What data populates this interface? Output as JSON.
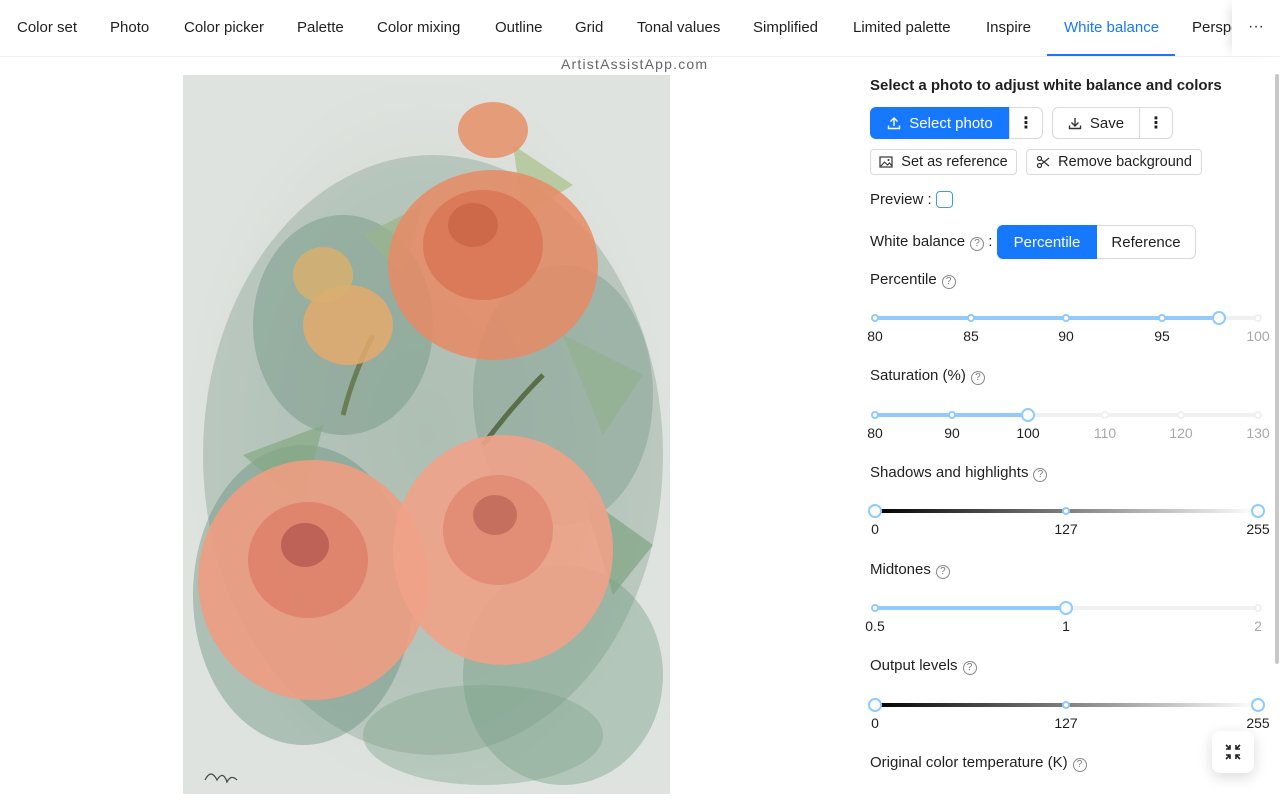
{
  "tabs": [
    {
      "label": "Color set"
    },
    {
      "label": "Photo"
    },
    {
      "label": "Color picker"
    },
    {
      "label": "Palette"
    },
    {
      "label": "Color mixing"
    },
    {
      "label": "Outline"
    },
    {
      "label": "Grid"
    },
    {
      "label": "Tonal values"
    },
    {
      "label": "Simplified"
    },
    {
      "label": "Limited palette"
    },
    {
      "label": "Inspire"
    },
    {
      "label": "White balance",
      "active": true
    },
    {
      "label": "Perspective"
    }
  ],
  "tab_more_icon": "ellipsis-icon",
  "watermark": "ArtistAssistApp.com",
  "panel": {
    "heading": "Select a photo to adjust white balance and colors",
    "select_photo": "Select photo",
    "save": "Save",
    "set_as_reference": "Set as reference",
    "remove_background": "Remove background",
    "preview_label": "Preview",
    "preview_checked": false,
    "white_balance_label": "White balance",
    "white_balance_options": [
      "Percentile",
      "Reference"
    ],
    "white_balance_selected": "Percentile",
    "percentile": {
      "label": "Percentile",
      "marks": [
        "80",
        "85",
        "90",
        "95",
        "100"
      ],
      "min": 80,
      "max": 100,
      "value": 98
    },
    "saturation": {
      "label": "Saturation (%)",
      "marks": [
        "80",
        "90",
        "100",
        "110",
        "120",
        "130"
      ],
      "min": 80,
      "max": 130,
      "value": 100
    },
    "shadows_highlights": {
      "label": "Shadows and highlights",
      "marks": [
        "0",
        "127",
        "255"
      ],
      "min": 0,
      "max": 255,
      "value": [
        0,
        255
      ]
    },
    "midtones": {
      "label": "Midtones",
      "marks": [
        "0.5",
        "1",
        "2"
      ],
      "value": 1
    },
    "output_levels": {
      "label": "Output levels",
      "marks": [
        "0",
        "127",
        "255"
      ],
      "min": 0,
      "max": 255,
      "value": [
        0,
        255
      ]
    },
    "color_temperature_label": "Original color temperature (K)"
  },
  "colors": {
    "accent": "#1677ff",
    "slider_track": "#91caff"
  }
}
